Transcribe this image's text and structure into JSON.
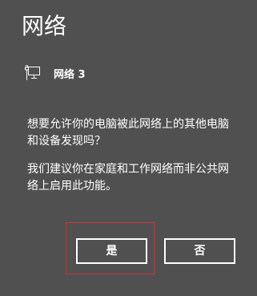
{
  "panel": {
    "title": "网络",
    "network": {
      "icon": "ethernet-monitor-icon",
      "name": "网络 3"
    },
    "question": "想要允许你的电脑被此网络上的其他电脑和设备发现吗？",
    "advice": "我们建议你在家庭和工作网络而非公共网络上启用此功能。",
    "buttons": {
      "yes": "是",
      "no": "否"
    }
  },
  "colors": {
    "background": "#505050",
    "text": "#ffffff",
    "focus": "#c8353a"
  }
}
